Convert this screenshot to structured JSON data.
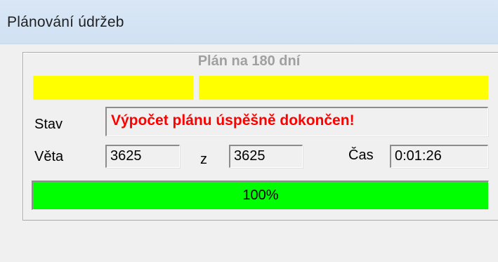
{
  "window": {
    "title": "Plánování údržeb"
  },
  "plan": {
    "heading": "Plán na 180 dní",
    "segment_color": "#ffff00"
  },
  "status": {
    "label": "Stav",
    "message": "Výpočet plánu úspěšně dokončen!",
    "message_color": "#ff0000"
  },
  "record": {
    "label": "Věta",
    "current": "3625",
    "of_label": "z",
    "total": "3625"
  },
  "time": {
    "label": "Čas",
    "value": "0:01:26"
  },
  "progress": {
    "percent": 100,
    "text": "100%",
    "fill_color": "#00ff00"
  }
}
